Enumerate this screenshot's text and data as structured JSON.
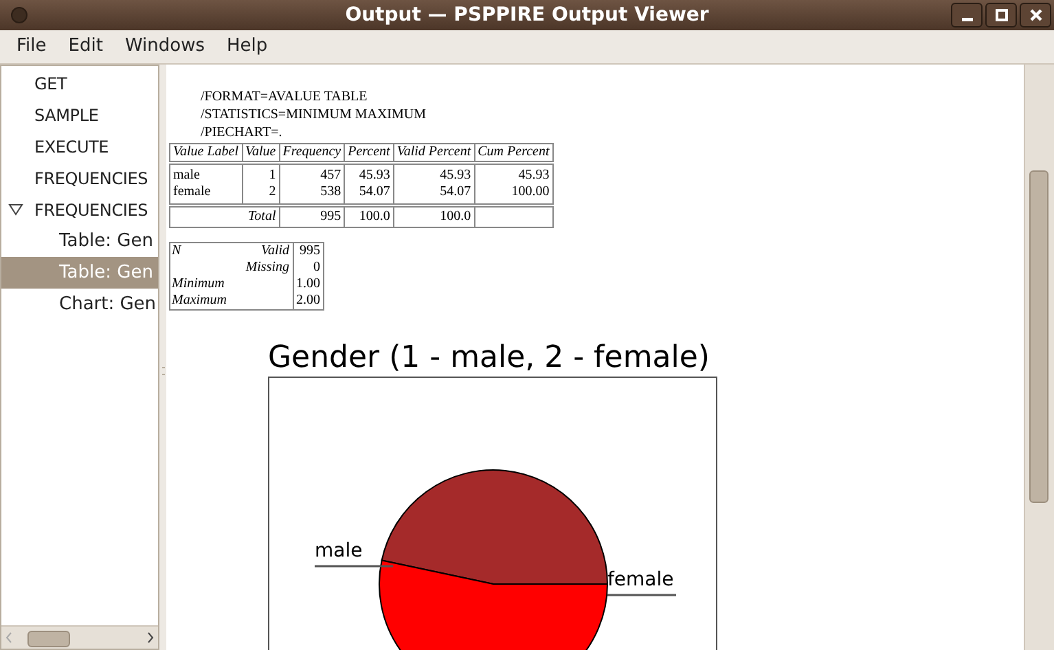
{
  "window": {
    "title": "Output — PSPPIRE Output Viewer"
  },
  "menu": [
    "File",
    "Edit",
    "Windows",
    "Help"
  ],
  "sidebar": {
    "items": [
      {
        "label": "GET",
        "selected": false
      },
      {
        "label": "SAMPLE",
        "selected": false
      },
      {
        "label": "EXECUTE",
        "selected": false
      },
      {
        "label": "FREQUENCIES",
        "selected": false
      },
      {
        "label": "FREQUENCIES",
        "selected": false,
        "expanded": true,
        "children": [
          {
            "label": "Table: Gen",
            "selected": false
          },
          {
            "label": "Table: Gen",
            "selected": true
          },
          {
            "label": "Chart: Gen",
            "selected": false
          }
        ]
      }
    ]
  },
  "syntax": [
    "/FORMAT=AVALUE TABLE",
    "/STATISTICS=MINIMUM MAXIMUM",
    "/PIECHART=."
  ],
  "frequency_table": {
    "columns": [
      "Value Label",
      "Value",
      "Frequency",
      "Percent",
      "Valid Percent",
      "Cum Percent"
    ],
    "rows": [
      [
        "male",
        "1",
        "457",
        "45.93",
        "45.93",
        "45.93"
      ],
      [
        "female",
        "2",
        "538",
        "54.07",
        "54.07",
        "100.00"
      ]
    ],
    "total": {
      "label": "Total",
      "cells": [
        "995",
        "100.0",
        "100.0",
        ""
      ]
    }
  },
  "statistics_table": {
    "rows": [
      {
        "label": "N",
        "sublabel": "Valid",
        "value": "995"
      },
      {
        "label": "",
        "sublabel": "Missing",
        "value": "0"
      },
      {
        "label": "Minimum",
        "sublabel": "",
        "value": "1.00"
      },
      {
        "label": "Maximum",
        "sublabel": "",
        "value": "2.00"
      }
    ]
  },
  "chart": {
    "title": "Gender (1 - male, 2 - female)",
    "slices": [
      {
        "label": "male",
        "color": "#a52a2a"
      },
      {
        "label": "female",
        "color": "#ff0000"
      }
    ]
  }
}
